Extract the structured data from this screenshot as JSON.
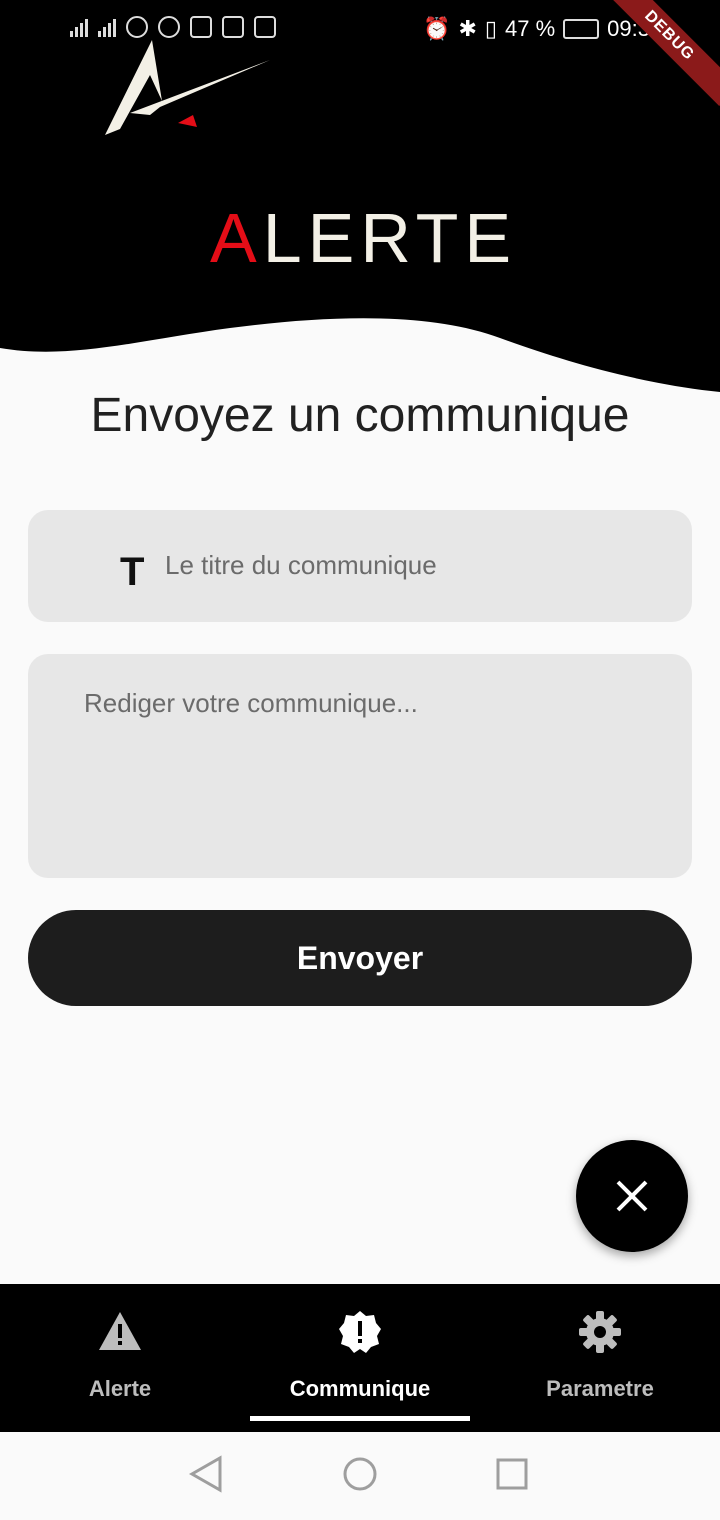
{
  "status_bar": {
    "battery": "47 %",
    "time": "09:3",
    "debug_banner": "DEBUG"
  },
  "header": {
    "brand_prefix": "A",
    "brand_rest": "LERTE",
    "brand_accent": "#e40d17",
    "brand_text_color": "#f3f0e6"
  },
  "page": {
    "title": "Envoyez un communique"
  },
  "form": {
    "title_icon": "T",
    "title_placeholder": "Le titre du communique",
    "body_placeholder": "Rediger votre communique...",
    "submit_label": "Envoyer"
  },
  "fab": {
    "icon": "close-icon"
  },
  "bottom_nav": {
    "items": [
      {
        "label": "Alerte",
        "icon": "warning-icon"
      },
      {
        "label": "Communique",
        "icon": "badge-alert-icon",
        "active": true
      },
      {
        "label": "Parametre",
        "icon": "gear-icon"
      }
    ]
  }
}
